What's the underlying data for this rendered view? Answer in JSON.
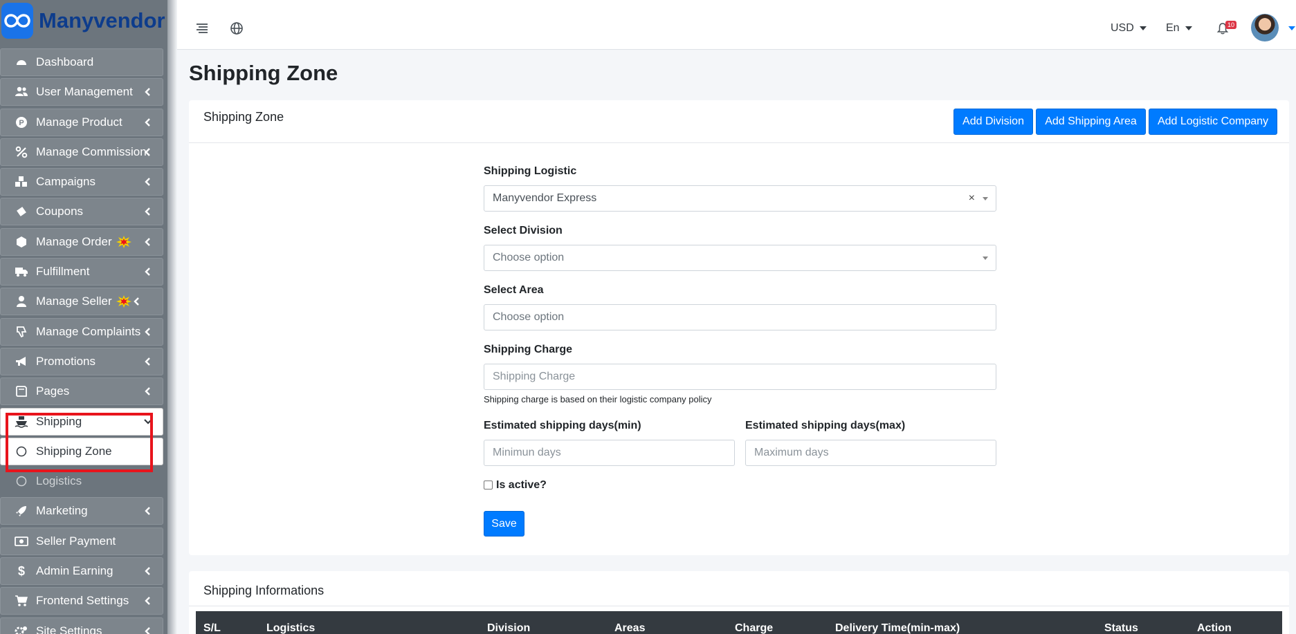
{
  "brand": {
    "name": "Manyvendor",
    "logo_icon": "infinity-logo-icon",
    "accent": "#1a73e8"
  },
  "sidebar": {
    "items": [
      {
        "label": "Dashboard",
        "icon": "gauge-icon",
        "chevron": false
      },
      {
        "label": "User Management",
        "icon": "users-icon",
        "chevron": true
      },
      {
        "label": "Manage Product",
        "icon": "product-p-icon",
        "chevron": true
      },
      {
        "label": "Manage Commission",
        "icon": "percent-icon",
        "chevron": true
      },
      {
        "label": "Campaigns",
        "icon": "cubes-icon",
        "chevron": true
      },
      {
        "label": "Coupons",
        "icon": "ticket-icon",
        "chevron": true
      },
      {
        "label": "Manage Order",
        "icon": "box-icon",
        "chevron": true,
        "badge": "new-burst-icon"
      },
      {
        "label": "Fulfillment",
        "icon": "truck-icon",
        "chevron": true
      },
      {
        "label": "Manage Seller",
        "icon": "user-icon",
        "chevron": true,
        "badge": "new-burst-icon"
      },
      {
        "label": "Manage Complaints",
        "icon": "thumbs-down-icon",
        "chevron": true
      },
      {
        "label": "Promotions",
        "icon": "bullhorn-icon",
        "chevron": true
      },
      {
        "label": "Pages",
        "icon": "book-icon",
        "chevron": true
      },
      {
        "label": "Shipping",
        "icon": "ship-icon",
        "chevron": true,
        "open": true
      },
      {
        "label": "Shipping Zone",
        "icon": "circle-icon",
        "sub": true,
        "active": true
      },
      {
        "label": "Logistics",
        "icon": "circle-icon",
        "sub": true
      },
      {
        "label": "Marketing",
        "icon": "rocket-icon",
        "chevron": true
      },
      {
        "label": "Seller Payment",
        "icon": "money-bill-icon",
        "chevron": false
      },
      {
        "label": "Admin Earning",
        "icon": "dollar-icon",
        "chevron": true
      },
      {
        "label": "Frontend Settings",
        "icon": "cart-icon",
        "chevron": true
      },
      {
        "label": "Site Settings",
        "icon": "cogs-icon",
        "chevron": true
      }
    ]
  },
  "topbar": {
    "menu_icon": "hamburger-icon",
    "globe_icon": "globe-icon",
    "currency": "USD",
    "language": "En",
    "notification_icon": "bell-icon",
    "notification_count": "10",
    "avatar_icon": "user-avatar"
  },
  "page": {
    "title": "Shipping Zone"
  },
  "form_card": {
    "title": "Shipping Zone",
    "buttons": {
      "add_division": "Add Division",
      "add_shipping_area": "Add Shipping Area",
      "add_logistic_company": "Add Logistic Company"
    },
    "fields": {
      "logistic": {
        "label": "Shipping Logistic",
        "value": "Manyvendor Express",
        "clear": "×"
      },
      "division": {
        "label": "Select Division",
        "placeholder": "Choose option"
      },
      "area": {
        "label": "Select Area",
        "placeholder": "Choose option"
      },
      "charge": {
        "label": "Shipping Charge",
        "placeholder": "Shipping Charge",
        "help": "Shipping charge is based on their logistic company policy"
      },
      "days_min": {
        "label": "Estimated shipping days(min)",
        "placeholder": "Minimun days"
      },
      "days_max": {
        "label": "Estimated shipping days(max)",
        "placeholder": "Maximum days"
      },
      "active": {
        "label": "Is active?",
        "checked": false
      }
    },
    "save_label": "Save",
    "primary_color": "#007bff"
  },
  "table_card": {
    "title": "Shipping Informations",
    "columns": [
      "S/L",
      "Logistics",
      "Division",
      "Areas",
      "Charge",
      "Delivery Time(min-max)",
      "Status",
      "Action"
    ]
  }
}
